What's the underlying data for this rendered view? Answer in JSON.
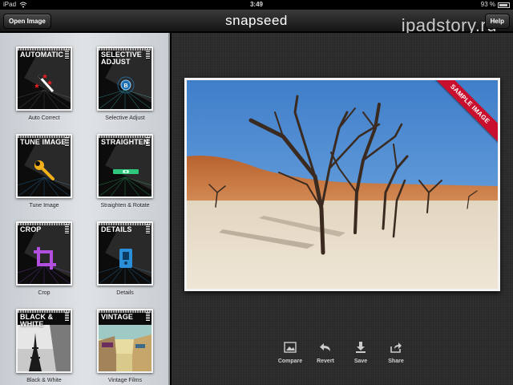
{
  "status_bar": {
    "carrier": "iPad",
    "time": "3:49",
    "battery": "93 %"
  },
  "toolbar": {
    "open_image_label": "Open Image",
    "app_name": "snapseed",
    "help_label": "Help",
    "watermark": "ipadstory.ru"
  },
  "filters": [
    {
      "title": "AUTOMATIC",
      "caption": "Auto Correct",
      "icon": "magic-wand-icon"
    },
    {
      "title": "SELECTIVE ADJUST",
      "caption": "Selective Adjust",
      "icon": "control-point-icon"
    },
    {
      "title": "TUNE IMAGE",
      "caption": "Tune Image",
      "icon": "wrench-icon"
    },
    {
      "title": "STRAIGHTEN",
      "caption": "Straighten & Rotate",
      "icon": "level-icon"
    },
    {
      "title": "CROP",
      "caption": "Crop",
      "icon": "crop-icon"
    },
    {
      "title": "DETAILS",
      "caption": "Details",
      "icon": "sharpener-icon"
    },
    {
      "title": "BLACK & WHITE",
      "caption": "Black & White",
      "icon": "eiffel-photo"
    },
    {
      "title": "VINTAGE",
      "caption": "Vintage Films",
      "icon": "vintage-photo"
    }
  ],
  "image": {
    "ribbon_label": "SAMPLE IMAGE"
  },
  "actions": [
    {
      "label": "Compare",
      "icon": "image-icon"
    },
    {
      "label": "Revert",
      "icon": "revert-arrow-icon"
    },
    {
      "label": "Save",
      "icon": "download-icon"
    },
    {
      "label": "Share",
      "icon": "share-icon"
    }
  ],
  "colors": {
    "ribbon": "#c8102e",
    "sky": "#3f7ec9",
    "sand": "#e6dcc8",
    "dune": "#c8743f",
    "tune_icon": "#f2b019",
    "crop_icon": "#b24fe0",
    "straighten_icon": "#2ec77c",
    "details_icon": "#2a8fd6"
  }
}
